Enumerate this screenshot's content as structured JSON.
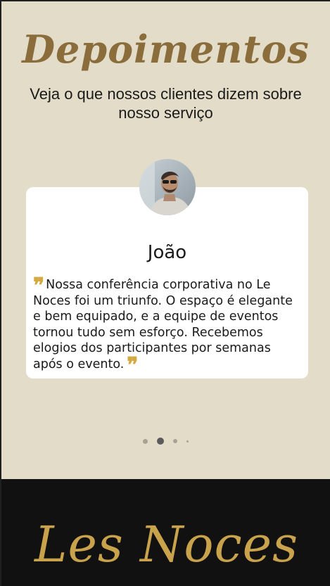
{
  "section": {
    "title": "Depoimentos",
    "subtitle": "Veja o que nossos clientes dizem sobre nosso serviço"
  },
  "testimonial": {
    "name": "João",
    "text": "Nossa conferência corporativa no Le Noces foi um triunfo. O espaço é elegante e bem equipado, e a equipe de eventos tornou tudo sem esforço. Recebemos elogios dos participantes por semanas após o evento.",
    "avatar_icon": "person-photo",
    "quote_color": "#d4a93f"
  },
  "carousel": {
    "slide_count": 4,
    "active_index": 1
  },
  "footer": {
    "brand": "Les Noces",
    "brand_color": "#c9a24c"
  },
  "colors": {
    "background": "#e2dcc8",
    "heading": "#8a6d3b",
    "footer_bg": "#111111"
  }
}
